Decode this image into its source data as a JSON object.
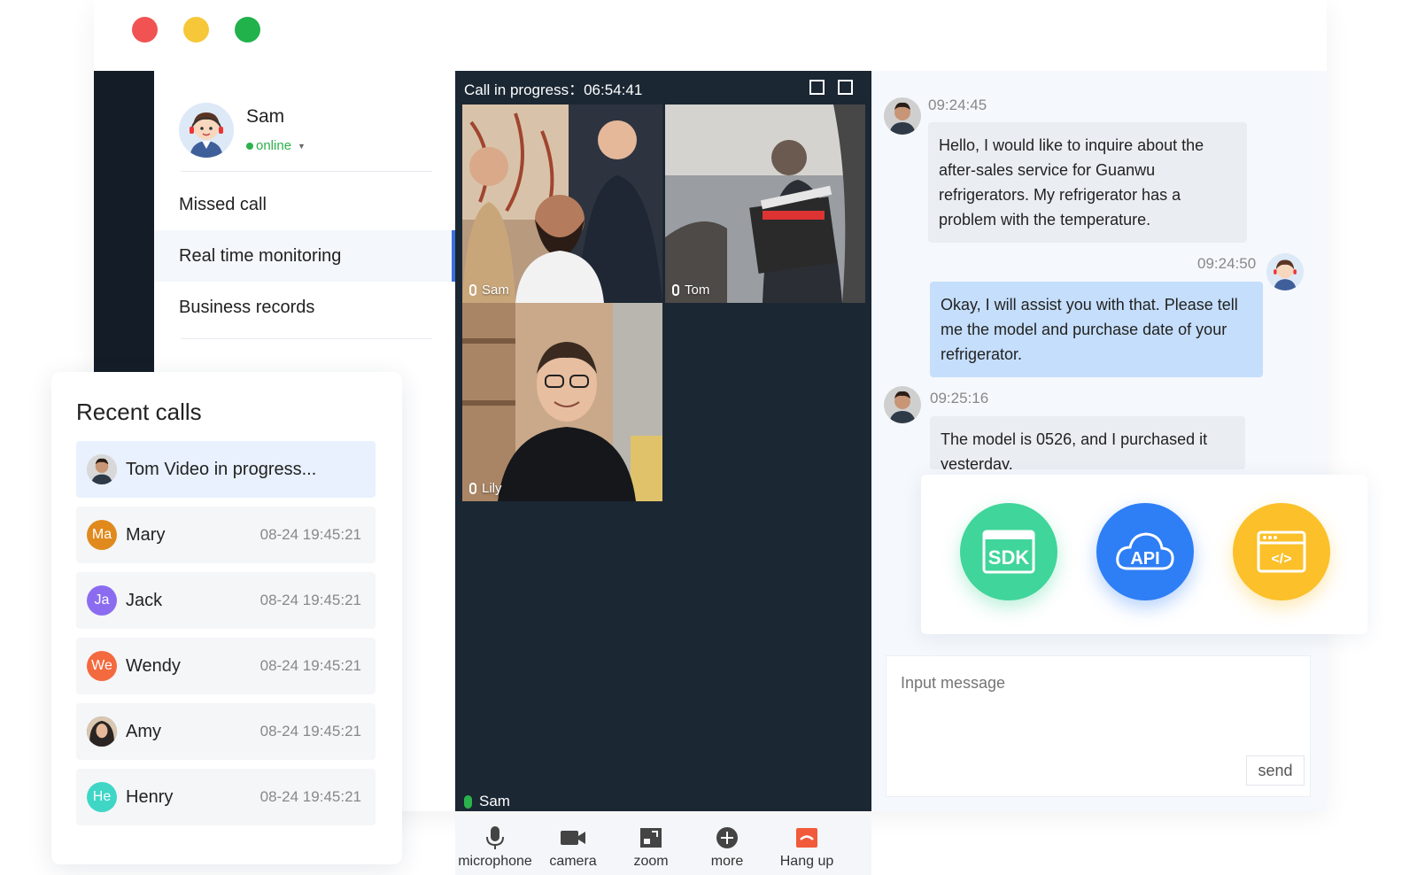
{
  "sidebar": {
    "user_name": "Sam",
    "status": "online",
    "nav": [
      {
        "label": "Missed call"
      },
      {
        "label": "Real time monitoring"
      },
      {
        "label": "Business records"
      }
    ]
  },
  "video": {
    "header": "Call in progress：06:54:41",
    "tiles": [
      {
        "name": "Sam"
      },
      {
        "name": "Tom"
      },
      {
        "name": "Lily"
      }
    ],
    "speaker": "Sam",
    "controls": [
      {
        "label": "microphone",
        "icon": "microphone-icon"
      },
      {
        "label": "camera",
        "icon": "camera-icon"
      },
      {
        "label": "zoom",
        "icon": "zoom-icon"
      },
      {
        "label": "more",
        "icon": "plus-circle-icon"
      },
      {
        "label": "Hang up",
        "icon": "hang-up-icon",
        "color": "#f15a3a"
      }
    ]
  },
  "chat": {
    "messages": [
      {
        "time": "09:24:45",
        "direction": "in",
        "text": "Hello, I would like to inquire about the after-sales service for Guanwu refrigerators. My refrigerator has a problem with the temperature."
      },
      {
        "time": "09:24:50",
        "direction": "out",
        "text": "Okay, I will assist you with that. Please tell me the model and purchase date of your refrigerator."
      },
      {
        "time": "09:25:16",
        "direction": "in",
        "text": "The model is 0526, and I purchased it yesterday."
      }
    ],
    "tools": [
      {
        "label": "SDK",
        "color": "#40d59a"
      },
      {
        "label": "API",
        "color": "#2e7ef6"
      },
      {
        "label": "</>",
        "color": "#fbc02a"
      }
    ],
    "input_placeholder": "Input message",
    "send_label": "send"
  },
  "recent": {
    "title": "Recent calls",
    "active_call": {
      "name": "Tom",
      "text": "Tom Video in progress..."
    },
    "calls": [
      {
        "initials": "Ma",
        "name": "Mary",
        "time": "08-24  19:45:21",
        "color": "#e08a1e"
      },
      {
        "initials": "Ja",
        "name": "Jack",
        "time": "08-24  19:45:21",
        "color": "#8b6cf0"
      },
      {
        "initials": "We",
        "name": "Wendy",
        "time": "08-24  19:45:21",
        "color": "#f36a3e"
      },
      {
        "initials": "",
        "name": "Amy",
        "time": "08-24  19:45:21",
        "color": "#5a6a7a"
      },
      {
        "initials": "He",
        "name": "Henry",
        "time": "08-24  19:45:21",
        "color": "#3fd6c6"
      }
    ]
  }
}
